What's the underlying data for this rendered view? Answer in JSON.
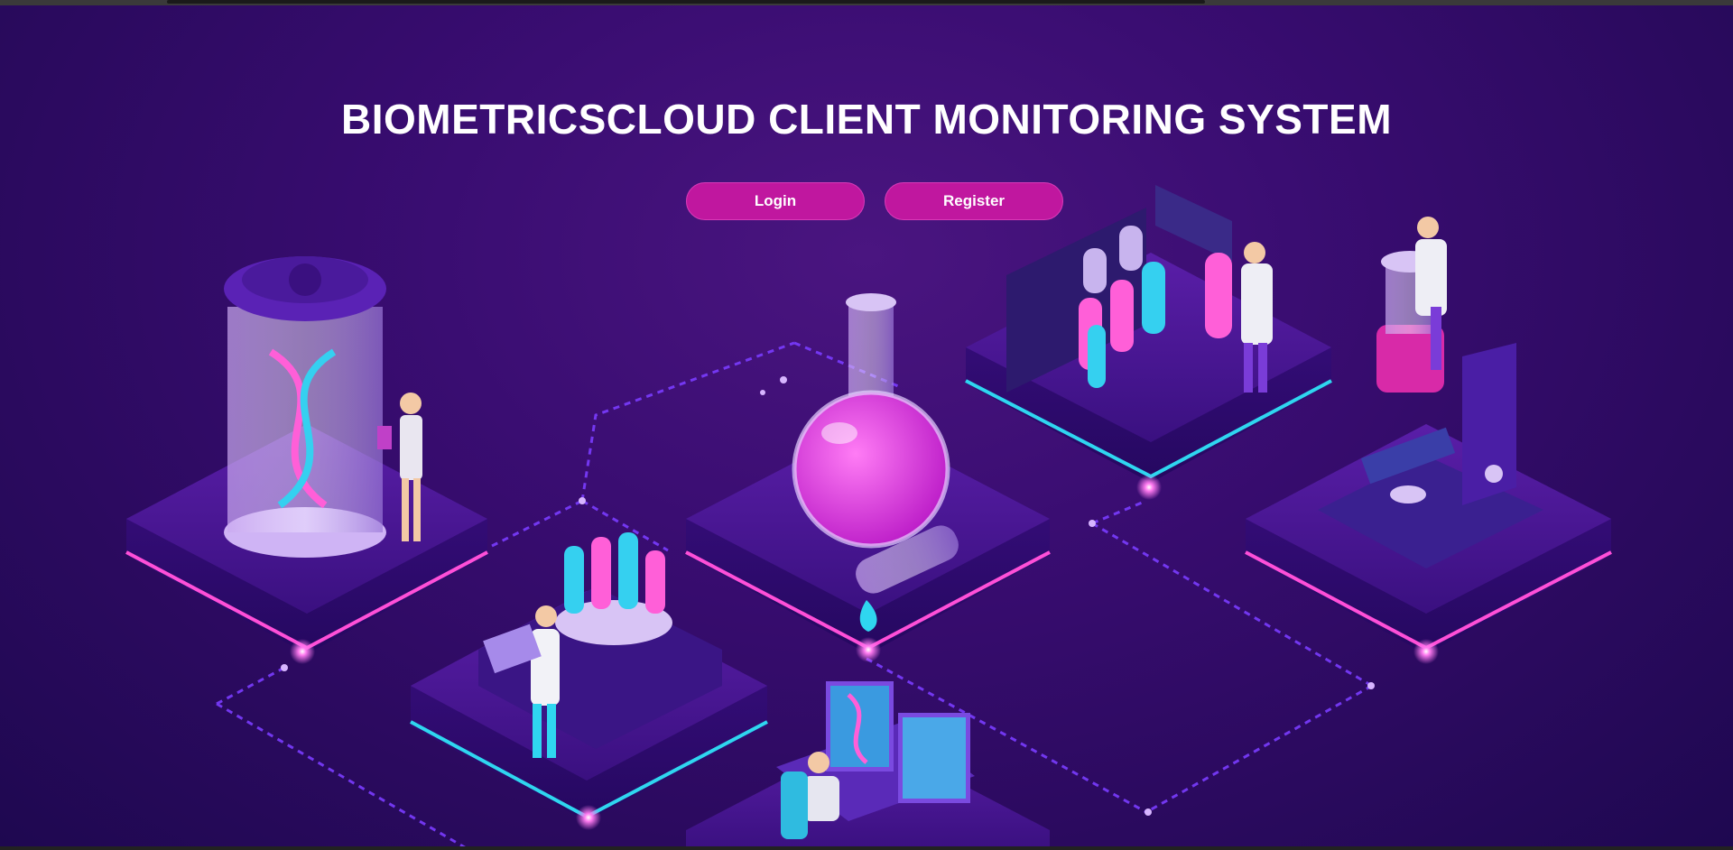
{
  "header": {
    "title": "BIOMETRICSCLOUD CLIENT MONITORING SYSTEM"
  },
  "actions": {
    "login_label": "Login",
    "register_label": "Register"
  },
  "colors": {
    "background": "#2b0a5f",
    "button": "#c0179f",
    "accent_cyan": "#2fd6f0",
    "accent_pink": "#ff3fd0"
  },
  "illustration": {
    "icons": [
      "dna-capsule-icon",
      "test-tube-rack-icon",
      "flask-icon",
      "test-tubes-stand-icon",
      "microscope-icon",
      "computer-workstation-icon"
    ]
  }
}
